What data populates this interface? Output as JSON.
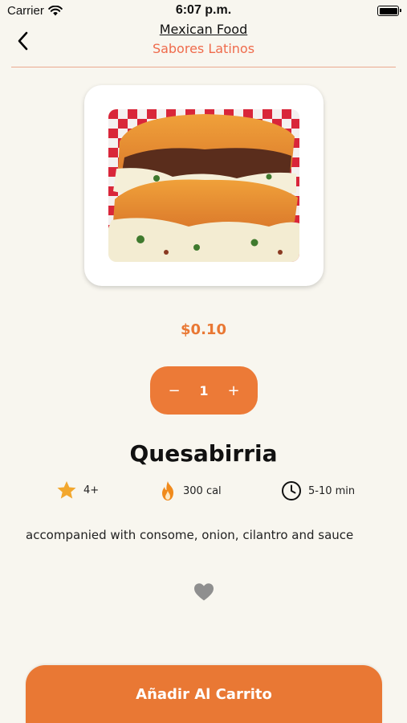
{
  "status_bar": {
    "carrier": "Carrier",
    "time": "6:07 p.m."
  },
  "header": {
    "title": "Mexican Food",
    "subtitle": "Sabores Latinos"
  },
  "product": {
    "price": "$0.10",
    "quantity": "1",
    "decrement_label": "−",
    "increment_label": "+",
    "name": "Quesabirria",
    "rating": "4+",
    "calories": "300 cal",
    "time": "5-10 min",
    "description": "accompanied with consome, onion, cilantro and sauce"
  },
  "actions": {
    "add_to_cart_label": "Añadir Al Carrito"
  },
  "colors": {
    "accent": "#e97834",
    "subtitle": "#ef6b4c",
    "background": "#f8f6ef",
    "star": "#f2a72e"
  },
  "icons": {
    "back": "chevron-left-icon",
    "rating": "star-icon",
    "calories": "flame-icon",
    "time": "clock-icon",
    "favorite": "heart-icon"
  }
}
